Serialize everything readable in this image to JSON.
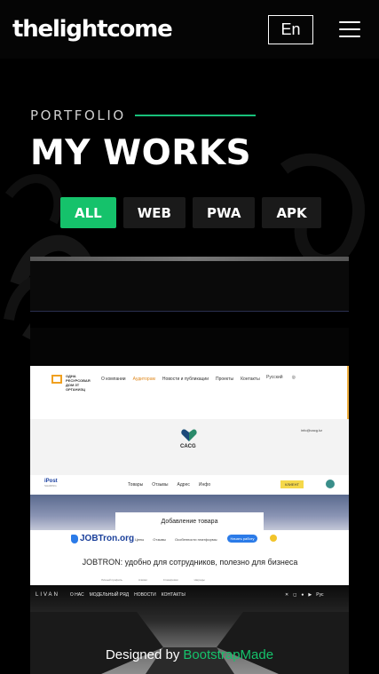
{
  "header": {
    "logo": "thelightcome",
    "lang_label": "En",
    "menu_icon": "hamburger-menu-icon"
  },
  "section": {
    "subtitle": "PORTFOLIO",
    "title": "MY WORKS",
    "accent_color": "#15c26b"
  },
  "filters": [
    {
      "label": "ALL",
      "active": true
    },
    {
      "label": "WEB",
      "active": false
    },
    {
      "label": "PWA",
      "active": false
    },
    {
      "label": "APK",
      "active": false
    }
  ],
  "gallery": {
    "shot1": {
      "brand": "ОДНА РЕСУРСОВАЯ ДОМ ЗТ ОРГАНИЗЦ",
      "nav": [
        "О компании",
        "Аудиторам",
        "Новости и публикации",
        "Проекты",
        "Контакты"
      ],
      "lang": "Русский"
    },
    "shot2": {
      "name": "CACG",
      "email": "info@cacg.kz"
    },
    "shot3": {
      "logo": "iPost",
      "logo_sub": "SHARING",
      "nav": [
        "Товары",
        "Отзывы",
        "Адрес",
        "Инфо"
      ],
      "button": "КЛИЕНТ"
    },
    "shot4": {
      "box_label": "Добавление товара"
    },
    "shot5": {
      "logo": "JOBTron.org",
      "nav": [
        "Цены",
        "Отзывы",
        "Особенности платформы"
      ],
      "button": "Начать работу",
      "headline": "JOBTRON: удобно для сотрудников, полезно для бизнеса",
      "footer": [
        "Личный профиль",
        "Ачивки",
        "Стажировки",
        "Награды"
      ]
    },
    "shot6": {
      "brand": "LIVAN",
      "nav": [
        "О НАС",
        "МОДЕЛЬНЫЙ РЯД",
        "НОВОСТИ",
        "КОНТАКТЫ"
      ],
      "lang": "Рус"
    }
  },
  "footer": {
    "credit_prefix": "Designed by",
    "credit_link": "BootstrapMade"
  }
}
